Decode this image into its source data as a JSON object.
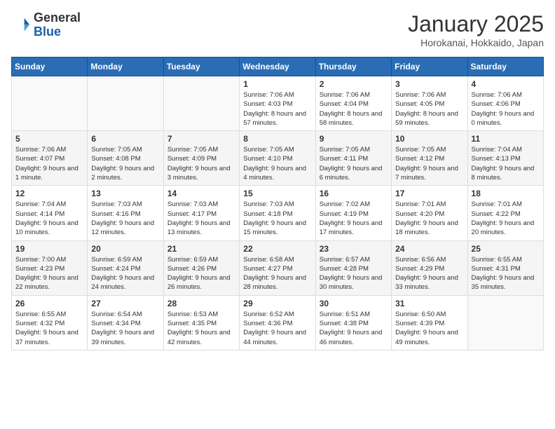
{
  "header": {
    "logo_general": "General",
    "logo_blue": "Blue",
    "month": "January 2025",
    "location": "Horokanai, Hokkaido, Japan"
  },
  "weekdays": [
    "Sunday",
    "Monday",
    "Tuesday",
    "Wednesday",
    "Thursday",
    "Friday",
    "Saturday"
  ],
  "weeks": [
    [
      {
        "day": "",
        "info": ""
      },
      {
        "day": "",
        "info": ""
      },
      {
        "day": "",
        "info": ""
      },
      {
        "day": "1",
        "info": "Sunrise: 7:06 AM\nSunset: 4:03 PM\nDaylight: 8 hours\nand 57 minutes."
      },
      {
        "day": "2",
        "info": "Sunrise: 7:06 AM\nSunset: 4:04 PM\nDaylight: 8 hours\nand 58 minutes."
      },
      {
        "day": "3",
        "info": "Sunrise: 7:06 AM\nSunset: 4:05 PM\nDaylight: 8 hours\nand 59 minutes."
      },
      {
        "day": "4",
        "info": "Sunrise: 7:06 AM\nSunset: 4:06 PM\nDaylight: 9 hours\nand 0 minutes."
      }
    ],
    [
      {
        "day": "5",
        "info": "Sunrise: 7:06 AM\nSunset: 4:07 PM\nDaylight: 9 hours\nand 1 minute."
      },
      {
        "day": "6",
        "info": "Sunrise: 7:05 AM\nSunset: 4:08 PM\nDaylight: 9 hours\nand 2 minutes."
      },
      {
        "day": "7",
        "info": "Sunrise: 7:05 AM\nSunset: 4:09 PM\nDaylight: 9 hours\nand 3 minutes."
      },
      {
        "day": "8",
        "info": "Sunrise: 7:05 AM\nSunset: 4:10 PM\nDaylight: 9 hours\nand 4 minutes."
      },
      {
        "day": "9",
        "info": "Sunrise: 7:05 AM\nSunset: 4:11 PM\nDaylight: 9 hours\nand 6 minutes."
      },
      {
        "day": "10",
        "info": "Sunrise: 7:05 AM\nSunset: 4:12 PM\nDaylight: 9 hours\nand 7 minutes."
      },
      {
        "day": "11",
        "info": "Sunrise: 7:04 AM\nSunset: 4:13 PM\nDaylight: 9 hours\nand 8 minutes."
      }
    ],
    [
      {
        "day": "12",
        "info": "Sunrise: 7:04 AM\nSunset: 4:14 PM\nDaylight: 9 hours\nand 10 minutes."
      },
      {
        "day": "13",
        "info": "Sunrise: 7:03 AM\nSunset: 4:16 PM\nDaylight: 9 hours\nand 12 minutes."
      },
      {
        "day": "14",
        "info": "Sunrise: 7:03 AM\nSunset: 4:17 PM\nDaylight: 9 hours\nand 13 minutes."
      },
      {
        "day": "15",
        "info": "Sunrise: 7:03 AM\nSunset: 4:18 PM\nDaylight: 9 hours\nand 15 minutes."
      },
      {
        "day": "16",
        "info": "Sunrise: 7:02 AM\nSunset: 4:19 PM\nDaylight: 9 hours\nand 17 minutes."
      },
      {
        "day": "17",
        "info": "Sunrise: 7:01 AM\nSunset: 4:20 PM\nDaylight: 9 hours\nand 18 minutes."
      },
      {
        "day": "18",
        "info": "Sunrise: 7:01 AM\nSunset: 4:22 PM\nDaylight: 9 hours\nand 20 minutes."
      }
    ],
    [
      {
        "day": "19",
        "info": "Sunrise: 7:00 AM\nSunset: 4:23 PM\nDaylight: 9 hours\nand 22 minutes."
      },
      {
        "day": "20",
        "info": "Sunrise: 6:59 AM\nSunset: 4:24 PM\nDaylight: 9 hours\nand 24 minutes."
      },
      {
        "day": "21",
        "info": "Sunrise: 6:59 AM\nSunset: 4:26 PM\nDaylight: 9 hours\nand 26 minutes."
      },
      {
        "day": "22",
        "info": "Sunrise: 6:58 AM\nSunset: 4:27 PM\nDaylight: 9 hours\nand 28 minutes."
      },
      {
        "day": "23",
        "info": "Sunrise: 6:57 AM\nSunset: 4:28 PM\nDaylight: 9 hours\nand 30 minutes."
      },
      {
        "day": "24",
        "info": "Sunrise: 6:56 AM\nSunset: 4:29 PM\nDaylight: 9 hours\nand 33 minutes."
      },
      {
        "day": "25",
        "info": "Sunrise: 6:55 AM\nSunset: 4:31 PM\nDaylight: 9 hours\nand 35 minutes."
      }
    ],
    [
      {
        "day": "26",
        "info": "Sunrise: 6:55 AM\nSunset: 4:32 PM\nDaylight: 9 hours\nand 37 minutes."
      },
      {
        "day": "27",
        "info": "Sunrise: 6:54 AM\nSunset: 4:34 PM\nDaylight: 9 hours\nand 39 minutes."
      },
      {
        "day": "28",
        "info": "Sunrise: 6:53 AM\nSunset: 4:35 PM\nDaylight: 9 hours\nand 42 minutes."
      },
      {
        "day": "29",
        "info": "Sunrise: 6:52 AM\nSunset: 4:36 PM\nDaylight: 9 hours\nand 44 minutes."
      },
      {
        "day": "30",
        "info": "Sunrise: 6:51 AM\nSunset: 4:38 PM\nDaylight: 9 hours\nand 46 minutes."
      },
      {
        "day": "31",
        "info": "Sunrise: 6:50 AM\nSunset: 4:39 PM\nDaylight: 9 hours\nand 49 minutes."
      },
      {
        "day": "",
        "info": ""
      }
    ]
  ]
}
